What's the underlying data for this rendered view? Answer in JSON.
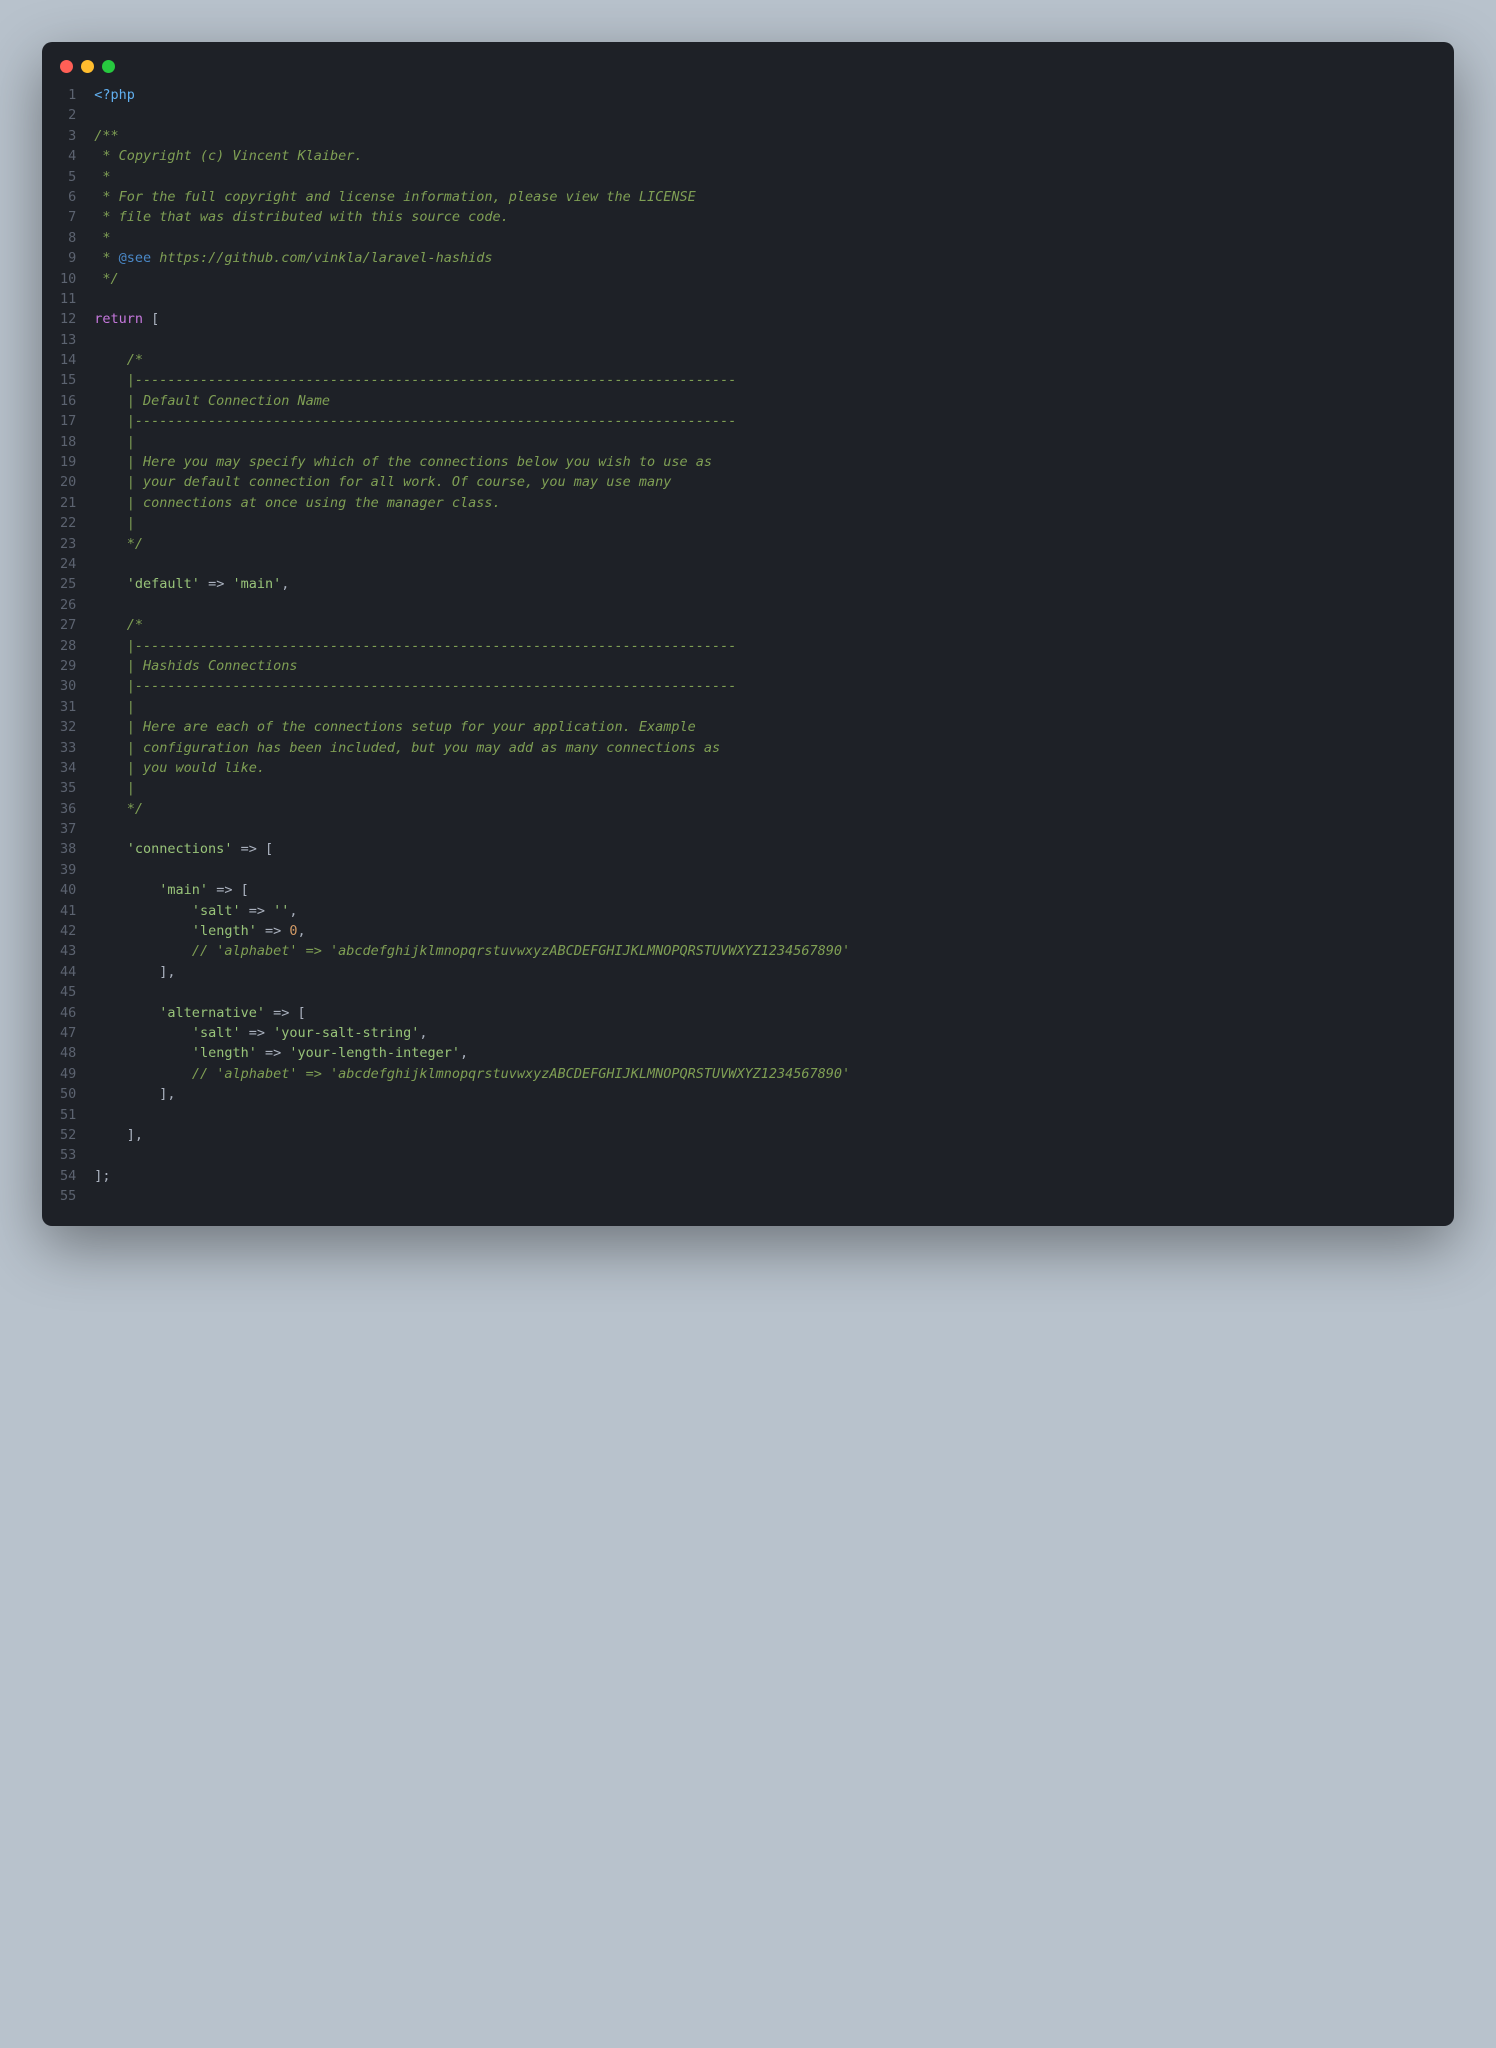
{
  "titlebar": {
    "buttons": [
      "close",
      "minimize",
      "zoom"
    ]
  },
  "gutter": {
    "start": 1,
    "end": 55
  },
  "code": {
    "lines": [
      [
        {
          "t": "php-open",
          "v": "<?php"
        }
      ],
      [],
      [
        {
          "t": "comment",
          "v": "/**"
        }
      ],
      [
        {
          "t": "comment",
          "v": " * Copyright (c) Vincent Klaiber."
        }
      ],
      [
        {
          "t": "comment",
          "v": " *"
        }
      ],
      [
        {
          "t": "comment",
          "v": " * For the full copyright and license information, please view the LICENSE"
        }
      ],
      [
        {
          "t": "comment",
          "v": " * file that was distributed with this source code."
        }
      ],
      [
        {
          "t": "comment",
          "v": " *"
        }
      ],
      [
        {
          "t": "comment",
          "v": " * "
        },
        {
          "t": "doctag",
          "v": "@see"
        },
        {
          "t": "comment",
          "v": " https://github.com/vinkla/laravel-hashids"
        }
      ],
      [
        {
          "t": "comment",
          "v": " */"
        }
      ],
      [],
      [
        {
          "t": "keyword",
          "v": "return"
        },
        {
          "t": "punct",
          "v": " ["
        }
      ],
      [],
      [
        {
          "t": "comment",
          "v": "    /*"
        }
      ],
      [
        {
          "t": "comment",
          "v": "    |--------------------------------------------------------------------------"
        }
      ],
      [
        {
          "t": "comment",
          "v": "    | Default Connection Name"
        }
      ],
      [
        {
          "t": "comment",
          "v": "    |--------------------------------------------------------------------------"
        }
      ],
      [
        {
          "t": "comment",
          "v": "    |"
        }
      ],
      [
        {
          "t": "comment",
          "v": "    | Here you may specify which of the connections below you wish to use as"
        }
      ],
      [
        {
          "t": "comment",
          "v": "    | your default connection for all work. Of course, you may use many"
        }
      ],
      [
        {
          "t": "comment",
          "v": "    | connections at once using the manager class."
        }
      ],
      [
        {
          "t": "comment",
          "v": "    |"
        }
      ],
      [
        {
          "t": "comment",
          "v": "    */"
        }
      ],
      [],
      [
        {
          "t": "punct",
          "v": "    "
        },
        {
          "t": "key",
          "v": "'default'"
        },
        {
          "t": "arrow",
          "v": " => "
        },
        {
          "t": "string",
          "v": "'main'"
        },
        {
          "t": "punct",
          "v": ","
        }
      ],
      [],
      [
        {
          "t": "comment",
          "v": "    /*"
        }
      ],
      [
        {
          "t": "comment",
          "v": "    |--------------------------------------------------------------------------"
        }
      ],
      [
        {
          "t": "comment",
          "v": "    | Hashids Connections"
        }
      ],
      [
        {
          "t": "comment",
          "v": "    |--------------------------------------------------------------------------"
        }
      ],
      [
        {
          "t": "comment",
          "v": "    |"
        }
      ],
      [
        {
          "t": "comment",
          "v": "    | Here are each of the connections setup for your application. Example"
        }
      ],
      [
        {
          "t": "comment",
          "v": "    | configuration has been included, but you may add as many connections as"
        }
      ],
      [
        {
          "t": "comment",
          "v": "    | you would like."
        }
      ],
      [
        {
          "t": "comment",
          "v": "    |"
        }
      ],
      [
        {
          "t": "comment",
          "v": "    */"
        }
      ],
      [],
      [
        {
          "t": "punct",
          "v": "    "
        },
        {
          "t": "key",
          "v": "'connections'"
        },
        {
          "t": "arrow",
          "v": " => "
        },
        {
          "t": "punct",
          "v": "["
        }
      ],
      [],
      [
        {
          "t": "punct",
          "v": "        "
        },
        {
          "t": "key",
          "v": "'main'"
        },
        {
          "t": "arrow",
          "v": " => "
        },
        {
          "t": "punct",
          "v": "["
        }
      ],
      [
        {
          "t": "punct",
          "v": "            "
        },
        {
          "t": "key",
          "v": "'salt'"
        },
        {
          "t": "arrow",
          "v": " => "
        },
        {
          "t": "string",
          "v": "''"
        },
        {
          "t": "punct",
          "v": ","
        }
      ],
      [
        {
          "t": "punct",
          "v": "            "
        },
        {
          "t": "key",
          "v": "'length'"
        },
        {
          "t": "arrow",
          "v": " => "
        },
        {
          "t": "number",
          "v": "0"
        },
        {
          "t": "punct",
          "v": ","
        }
      ],
      [
        {
          "t": "punct",
          "v": "            "
        },
        {
          "t": "line-comment",
          "v": "// 'alphabet' => 'abcdefghijklmnopqrstuvwxyzABCDEFGHIJKLMNOPQRSTUVWXYZ1234567890'"
        }
      ],
      [
        {
          "t": "punct",
          "v": "        ],"
        }
      ],
      [],
      [
        {
          "t": "punct",
          "v": "        "
        },
        {
          "t": "key",
          "v": "'alternative'"
        },
        {
          "t": "arrow",
          "v": " => "
        },
        {
          "t": "punct",
          "v": "["
        }
      ],
      [
        {
          "t": "punct",
          "v": "            "
        },
        {
          "t": "key",
          "v": "'salt'"
        },
        {
          "t": "arrow",
          "v": " => "
        },
        {
          "t": "string",
          "v": "'your-salt-string'"
        },
        {
          "t": "punct",
          "v": ","
        }
      ],
      [
        {
          "t": "punct",
          "v": "            "
        },
        {
          "t": "key",
          "v": "'length'"
        },
        {
          "t": "arrow",
          "v": " => "
        },
        {
          "t": "string",
          "v": "'your-length-integer'"
        },
        {
          "t": "punct",
          "v": ","
        }
      ],
      [
        {
          "t": "punct",
          "v": "            "
        },
        {
          "t": "line-comment",
          "v": "// 'alphabet' => 'abcdefghijklmnopqrstuvwxyzABCDEFGHIJKLMNOPQRSTUVWXYZ1234567890'"
        }
      ],
      [
        {
          "t": "punct",
          "v": "        ],"
        }
      ],
      [],
      [
        {
          "t": "punct",
          "v": "    ],"
        }
      ],
      [],
      [
        {
          "t": "punct",
          "v": "];"
        }
      ],
      []
    ]
  }
}
